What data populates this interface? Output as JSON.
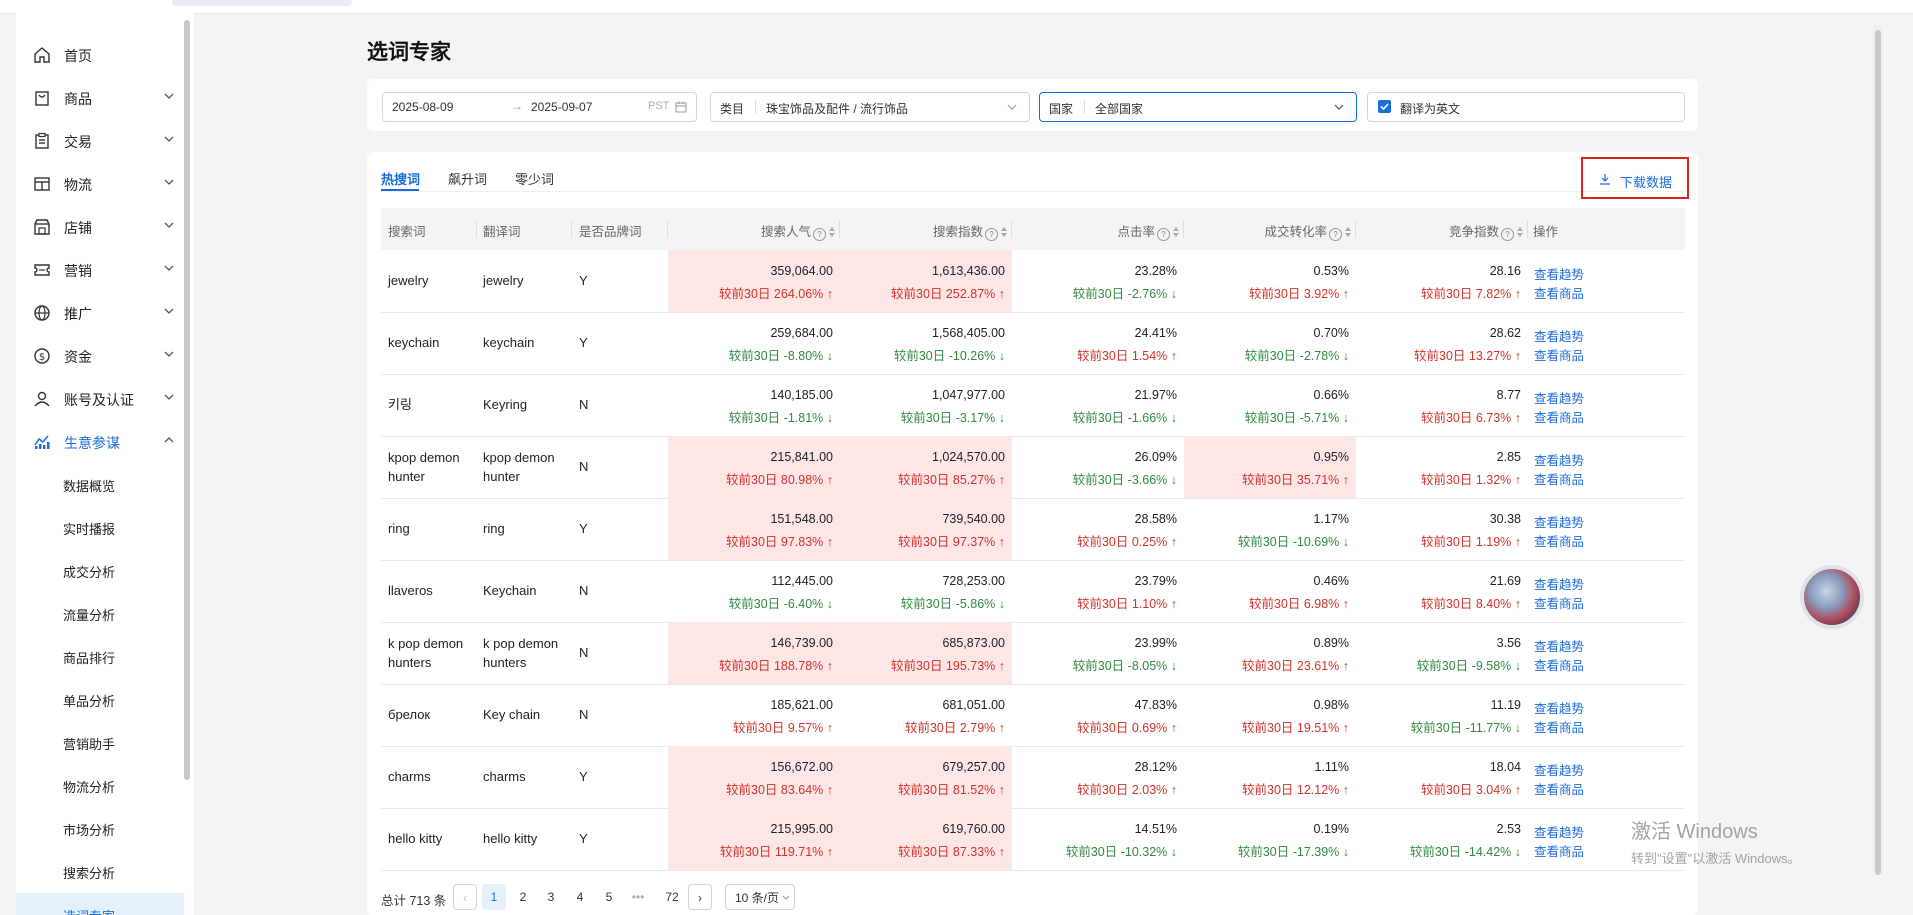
{
  "sidebar": {
    "items": [
      {
        "label": "首页",
        "icon": "home-icon",
        "has_chevron": false
      },
      {
        "label": "商品",
        "icon": "bag-icon",
        "has_chevron": true
      },
      {
        "label": "交易",
        "icon": "clipboard-icon",
        "has_chevron": true
      },
      {
        "label": "物流",
        "icon": "truck-icon",
        "has_chevron": true
      },
      {
        "label": "店铺",
        "icon": "store-icon",
        "has_chevron": true
      },
      {
        "label": "营销",
        "icon": "ticket-icon",
        "has_chevron": true
      },
      {
        "label": "推广",
        "icon": "globe-icon",
        "has_chevron": true
      },
      {
        "label": "资金",
        "icon": "dollar-icon",
        "has_chevron": true
      },
      {
        "label": "账号及认证",
        "icon": "user-icon",
        "has_chevron": true
      },
      {
        "label": "生意参谋",
        "icon": "chart-icon",
        "has_chevron": true,
        "active": true
      }
    ],
    "sub_items": [
      {
        "label": "数据概览"
      },
      {
        "label": "实时播报"
      },
      {
        "label": "成交分析"
      },
      {
        "label": "流量分析"
      },
      {
        "label": "商品排行"
      },
      {
        "label": "单品分析"
      },
      {
        "label": "营销助手"
      },
      {
        "label": "物流分析"
      },
      {
        "label": "市场分析"
      },
      {
        "label": "搜索分析"
      },
      {
        "label": "选词专家",
        "active": true
      }
    ]
  },
  "page": {
    "title": "选词专家"
  },
  "filters": {
    "date_start": "2025-08-09",
    "date_end": "2025-09-07",
    "timezone": "PST",
    "category_label": "类目",
    "category_value": "珠宝饰品及配件 / 流行饰品",
    "country_label": "国家",
    "country_value": "全部国家",
    "translate_label": "翻译为英文",
    "translate_checked": true
  },
  "tabs": [
    {
      "label": "热搜词",
      "active": true
    },
    {
      "label": "飙升词",
      "active": false
    },
    {
      "label": "零少词",
      "active": false
    }
  ],
  "download_label": "下载数据",
  "table": {
    "headers": {
      "keyword": "搜索词",
      "translation": "翻译词",
      "brand": "是否品牌词",
      "popularity": "搜索人气",
      "index": "搜索指数",
      "ctr": "点击率",
      "conversion": "成交转化率",
      "competition": "竞争指数",
      "actions": "操作"
    },
    "rows": [
      {
        "keyword": "jewelry",
        "translation": "jewelry",
        "brand": "Y",
        "popularity": "359,064.00",
        "popularity_chg": "较前30日 264.06% ↑",
        "popularity_dir": "up",
        "popularity_hl": true,
        "index": "1,613,436.00",
        "index_chg": "较前30日 252.87% ↑",
        "index_dir": "up",
        "index_hl": true,
        "ctr": "23.28%",
        "ctr_chg": "较前30日 -2.76% ↓",
        "ctr_dir": "down",
        "ctr_hl": false,
        "conversion": "0.53%",
        "conversion_chg": "较前30日 3.92% ↑",
        "conversion_dir": "up",
        "conversion_hl": false,
        "competition": "28.16",
        "competition_chg": "较前30日 7.82% ↑",
        "competition_dir": "up"
      },
      {
        "keyword": "keychain",
        "translation": "keychain",
        "brand": "Y",
        "popularity": "259,684.00",
        "popularity_chg": "较前30日 -8.80% ↓",
        "popularity_dir": "down",
        "popularity_hl": false,
        "index": "1,568,405.00",
        "index_chg": "较前30日 -10.26% ↓",
        "index_dir": "down",
        "index_hl": false,
        "ctr": "24.41%",
        "ctr_chg": "较前30日 1.54% ↑",
        "ctr_dir": "up",
        "ctr_hl": false,
        "conversion": "0.70%",
        "conversion_chg": "较前30日 -2.78% ↓",
        "conversion_dir": "down",
        "conversion_hl": false,
        "competition": "28.62",
        "competition_chg": "较前30日 13.27% ↑",
        "competition_dir": "up"
      },
      {
        "keyword": "키링",
        "translation": "Keyring",
        "brand": "N",
        "popularity": "140,185.00",
        "popularity_chg": "较前30日 -1.81% ↓",
        "popularity_dir": "down",
        "popularity_hl": false,
        "index": "1,047,977.00",
        "index_chg": "较前30日 -3.17% ↓",
        "index_dir": "down",
        "index_hl": false,
        "ctr": "21.97%",
        "ctr_chg": "较前30日 -1.66% ↓",
        "ctr_dir": "down",
        "ctr_hl": false,
        "conversion": "0.66%",
        "conversion_chg": "较前30日 -5.71% ↓",
        "conversion_dir": "down",
        "conversion_hl": false,
        "competition": "8.77",
        "competition_chg": "较前30日 6.73% ↑",
        "competition_dir": "up"
      },
      {
        "keyword": "kpop demon hunter",
        "translation": "kpop demon hunter",
        "brand": "N",
        "popularity": "215,841.00",
        "popularity_chg": "较前30日 80.98% ↑",
        "popularity_dir": "up",
        "popularity_hl": true,
        "index": "1,024,570.00",
        "index_chg": "较前30日 85.27% ↑",
        "index_dir": "up",
        "index_hl": true,
        "ctr": "26.09%",
        "ctr_chg": "较前30日 -3.66% ↓",
        "ctr_dir": "down",
        "ctr_hl": false,
        "conversion": "0.95%",
        "conversion_chg": "较前30日 35.71% ↑",
        "conversion_dir": "up",
        "conversion_hl": true,
        "competition": "2.85",
        "competition_chg": "较前30日 1.32% ↑",
        "competition_dir": "up"
      },
      {
        "keyword": "ring",
        "translation": "ring",
        "brand": "Y",
        "popularity": "151,548.00",
        "popularity_chg": "较前30日 97.83% ↑",
        "popularity_dir": "up",
        "popularity_hl": true,
        "index": "739,540.00",
        "index_chg": "较前30日 97.37% ↑",
        "index_dir": "up",
        "index_hl": true,
        "ctr": "28.58%",
        "ctr_chg": "较前30日 0.25% ↑",
        "ctr_dir": "up",
        "ctr_hl": false,
        "conversion": "1.17%",
        "conversion_chg": "较前30日 -10.69% ↓",
        "conversion_dir": "down",
        "conversion_hl": false,
        "competition": "30.38",
        "competition_chg": "较前30日 1.19% ↑",
        "competition_dir": "up"
      },
      {
        "keyword": "llaveros",
        "translation": "Keychain",
        "brand": "N",
        "popularity": "112,445.00",
        "popularity_chg": "较前30日 -6.40% ↓",
        "popularity_dir": "down",
        "popularity_hl": false,
        "index": "728,253.00",
        "index_chg": "较前30日 -5.86% ↓",
        "index_dir": "down",
        "index_hl": false,
        "ctr": "23.79%",
        "ctr_chg": "较前30日 1.10% ↑",
        "ctr_dir": "up",
        "ctr_hl": false,
        "conversion": "0.46%",
        "conversion_chg": "较前30日 6.98% ↑",
        "conversion_dir": "up",
        "conversion_hl": false,
        "competition": "21.69",
        "competition_chg": "较前30日 8.40% ↑",
        "competition_dir": "up"
      },
      {
        "keyword": "k pop demon hunters",
        "translation": "k pop demon hunters",
        "brand": "N",
        "popularity": "146,739.00",
        "popularity_chg": "较前30日 188.78% ↑",
        "popularity_dir": "up",
        "popularity_hl": true,
        "index": "685,873.00",
        "index_chg": "较前30日 195.73% ↑",
        "index_dir": "up",
        "index_hl": true,
        "ctr": "23.99%",
        "ctr_chg": "较前30日 -8.05% ↓",
        "ctr_dir": "down",
        "ctr_hl": false,
        "conversion": "0.89%",
        "conversion_chg": "较前30日 23.61% ↑",
        "conversion_dir": "up",
        "conversion_hl": false,
        "competition": "3.56",
        "competition_chg": "较前30日 -9.58% ↓",
        "competition_dir": "down"
      },
      {
        "keyword": "брелок",
        "translation": "Key chain",
        "brand": "N",
        "popularity": "185,621.00",
        "popularity_chg": "较前30日 9.57% ↑",
        "popularity_dir": "up",
        "popularity_hl": false,
        "index": "681,051.00",
        "index_chg": "较前30日 2.79% ↑",
        "index_dir": "up",
        "index_hl": false,
        "ctr": "47.83%",
        "ctr_chg": "较前30日 0.69% ↑",
        "ctr_dir": "up",
        "ctr_hl": false,
        "conversion": "0.98%",
        "conversion_chg": "较前30日 19.51% ↑",
        "conversion_dir": "up",
        "conversion_hl": false,
        "competition": "11.19",
        "competition_chg": "较前30日 -11.77% ↓",
        "competition_dir": "down"
      },
      {
        "keyword": "charms",
        "translation": "charms",
        "brand": "Y",
        "popularity": "156,672.00",
        "popularity_chg": "较前30日 83.64% ↑",
        "popularity_dir": "up",
        "popularity_hl": true,
        "index": "679,257.00",
        "index_chg": "较前30日 81.52% ↑",
        "index_dir": "up",
        "index_hl": true,
        "ctr": "28.12%",
        "ctr_chg": "较前30日 2.03% ↑",
        "ctr_dir": "up",
        "ctr_hl": false,
        "conversion": "1.11%",
        "conversion_chg": "较前30日 12.12% ↑",
        "conversion_dir": "up",
        "conversion_hl": false,
        "competition": "18.04",
        "competition_chg": "较前30日 3.04% ↑",
        "competition_dir": "up"
      },
      {
        "keyword": "hello kitty",
        "translation": "hello kitty",
        "brand": "Y",
        "popularity": "215,995.00",
        "popularity_chg": "较前30日 119.71% ↑",
        "popularity_dir": "up",
        "popularity_hl": true,
        "index": "619,760.00",
        "index_chg": "较前30日 87.33% ↑",
        "index_dir": "up",
        "index_hl": true,
        "ctr": "14.51%",
        "ctr_chg": "较前30日 -10.32% ↓",
        "ctr_dir": "down",
        "ctr_hl": false,
        "conversion": "0.19%",
        "conversion_chg": "较前30日 -17.39% ↓",
        "conversion_dir": "down",
        "conversion_hl": false,
        "competition": "2.53",
        "competition_chg": "较前30日 -14.42% ↓",
        "competition_dir": "down"
      }
    ],
    "action_trend": "查看趋势",
    "action_products": "查看商品"
  },
  "pagination": {
    "total": "总计 713 条",
    "pages": [
      "1",
      "2",
      "3",
      "4",
      "5",
      "•••",
      "72"
    ],
    "current": "1",
    "page_size": "10 条/页"
  },
  "watermark": {
    "line1": "激活 Windows",
    "line2": "转到\"设置\"以激活 Windows。"
  },
  "colors": {
    "accent": "#1a6ddb",
    "up": "#d4322a",
    "down": "#2e8b3e",
    "highlight": "#fde6e6",
    "download_border": "#e0211c"
  }
}
